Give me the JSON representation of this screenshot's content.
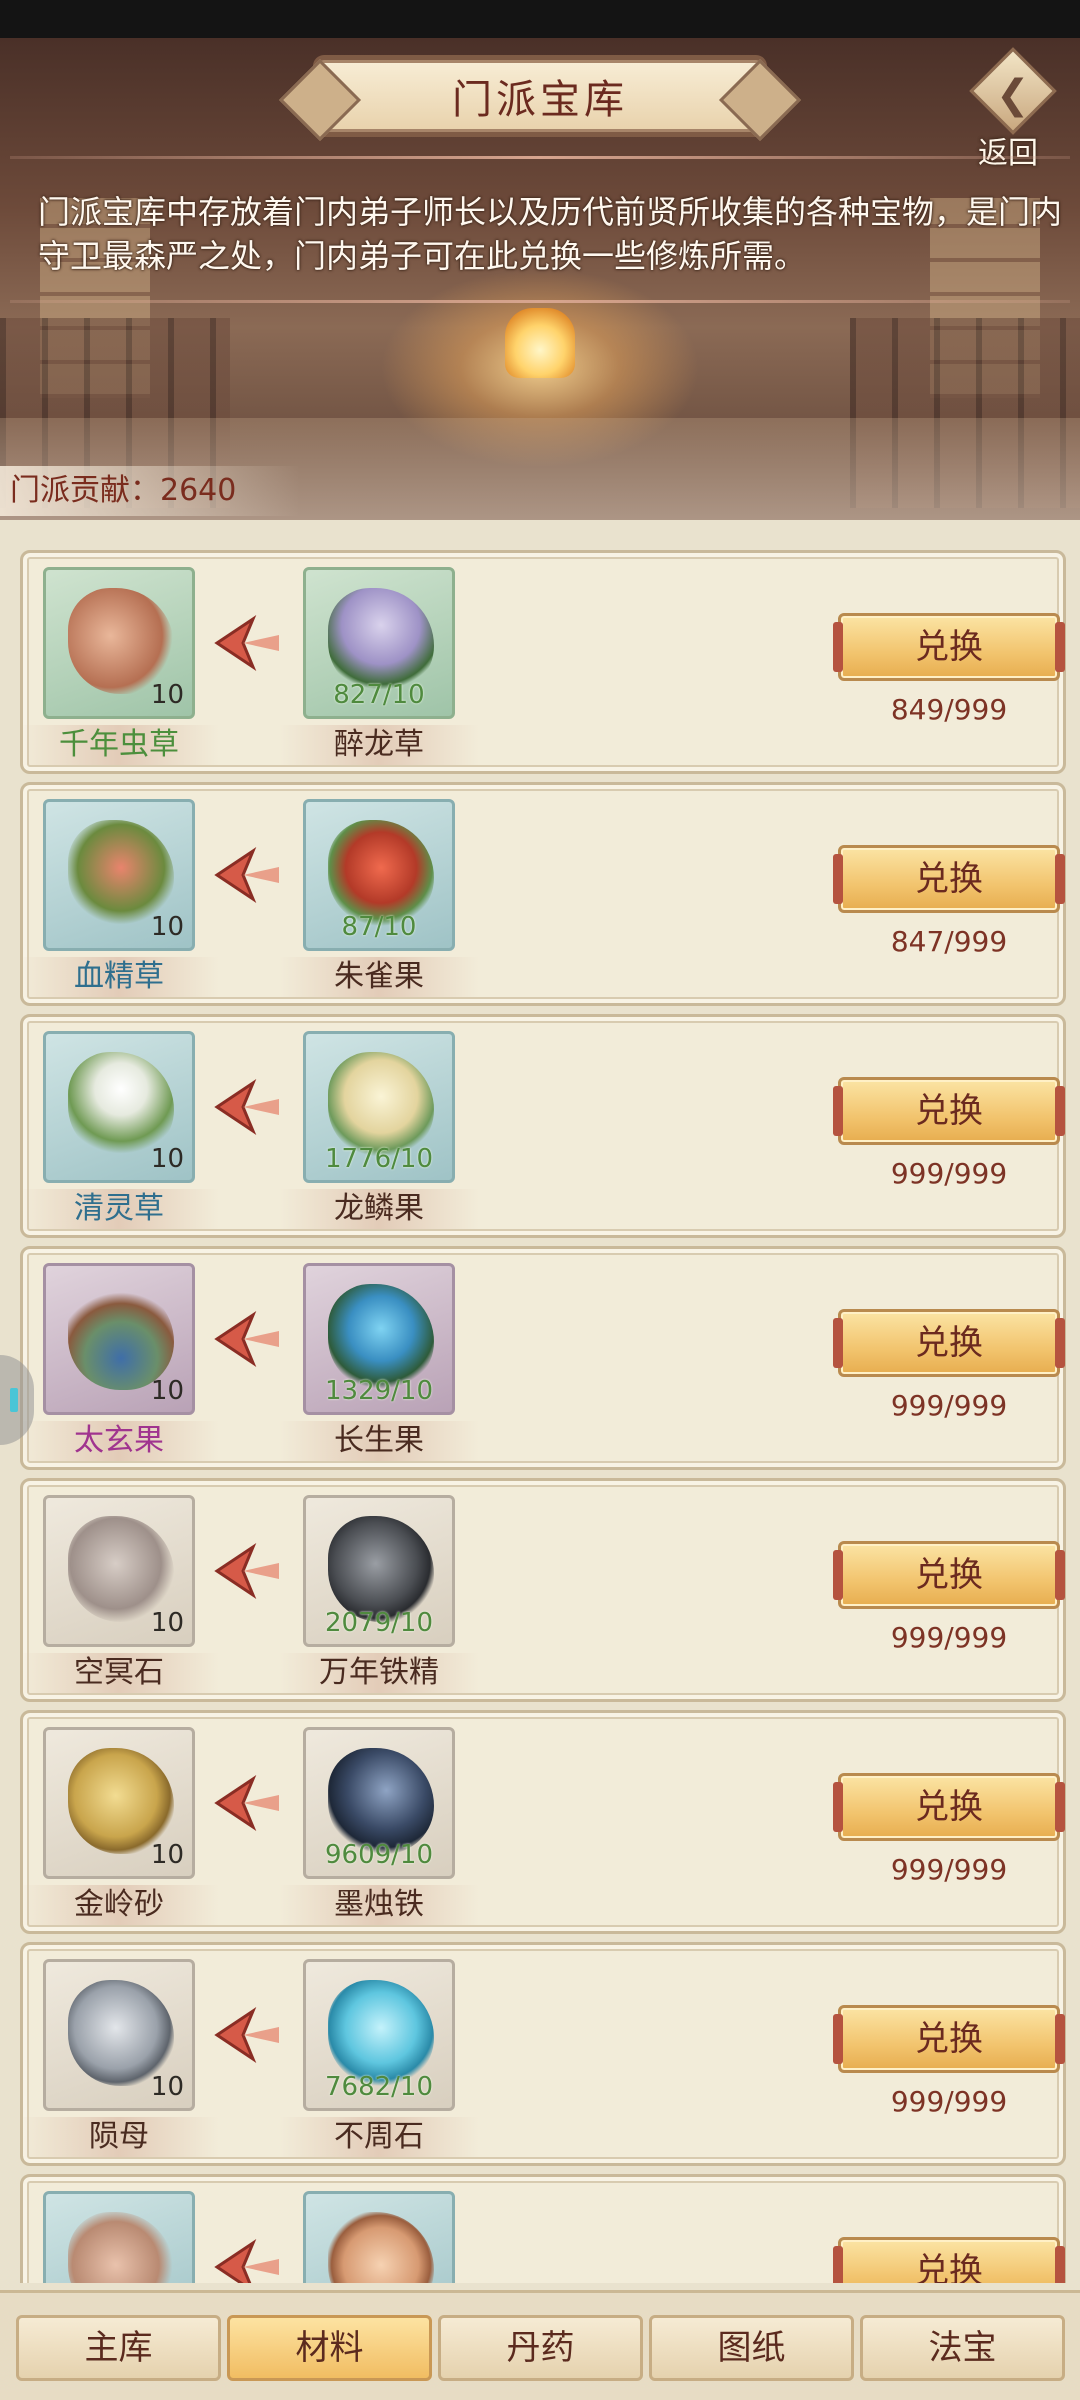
{
  "header": {
    "title": "门派宝库",
    "back_label": "返回",
    "description": "门派宝库中存放着门内弟子师长以及历代前贤所收集的各种宝物，是门内守卫最森严之处，门内弟子可在此兑换一些修炼所需。",
    "contribution_label": "门派贡献：2640"
  },
  "items": [
    {
      "target_name": "千年虫草",
      "target_qty": "10",
      "target_rarity": "green",
      "source_name": "醉龙草",
      "source_qty": "827/10",
      "source_rarity": "green",
      "button": "兑换",
      "stock": "849/999"
    },
    {
      "target_name": "血精草",
      "target_qty": "10",
      "target_rarity": "blue",
      "source_name": "朱雀果",
      "source_qty": "87/10",
      "source_rarity": "blue",
      "button": "兑换",
      "stock": "847/999"
    },
    {
      "target_name": "清灵草",
      "target_qty": "10",
      "target_rarity": "blue",
      "source_name": "龙鳞果",
      "source_qty": "1776/10",
      "source_rarity": "blue",
      "button": "兑换",
      "stock": "999/999"
    },
    {
      "target_name": "太玄果",
      "target_qty": "10",
      "target_rarity": "purple",
      "source_name": "长生果",
      "source_qty": "1329/10",
      "source_rarity": "purple",
      "button": "兑换",
      "stock": "999/999"
    },
    {
      "target_name": "空冥石",
      "target_qty": "10",
      "target_rarity": "grey",
      "source_name": "万年铁精",
      "source_qty": "2079/10",
      "source_rarity": "grey",
      "button": "兑换",
      "stock": "999/999"
    },
    {
      "target_name": "金岭砂",
      "target_qty": "10",
      "target_rarity": "grey",
      "source_name": "墨烛铁",
      "source_qty": "9609/10",
      "source_rarity": "grey",
      "button": "兑换",
      "stock": "999/999"
    },
    {
      "target_name": "陨母",
      "target_qty": "10",
      "target_rarity": "grey",
      "source_name": "不周石",
      "source_qty": "7682/10",
      "source_rarity": "grey",
      "button": "兑换",
      "stock": "999/999"
    },
    {
      "target_name": "",
      "target_qty": "",
      "target_rarity": "blue",
      "source_name": "",
      "source_qty": "",
      "source_rarity": "blue",
      "button": "兑换",
      "stock": ""
    }
  ],
  "tabs": [
    {
      "label": "主库",
      "active": false
    },
    {
      "label": "材料",
      "active": true
    },
    {
      "label": "丹药",
      "active": false
    },
    {
      "label": "图纸",
      "active": false
    },
    {
      "label": "法宝",
      "active": false
    }
  ],
  "colors": {
    "rarity_green": "#4c8f3c",
    "rarity_blue": "#2f6f8e",
    "rarity_purple": "#a0348f",
    "stock_text": "#7d3325",
    "button_gold": "#f2c46e"
  },
  "icons": {
    "item_1_target": "cordyceps-icon",
    "item_1_source": "lavender-herb-icon",
    "item_2_target": "blood-herb-icon",
    "item_2_source": "red-berry-icon",
    "item_3_target": "white-flower-icon",
    "item_3_source": "dragon-scale-fruit-icon",
    "item_4_target": "blue-fruit-branch-icon",
    "item_4_source": "blue-berry-vine-icon",
    "item_5_target": "pale-stone-icon",
    "item_5_source": "dark-iron-ore-icon",
    "item_6_target": "gold-sand-icon",
    "item_6_source": "black-crystal-iron-icon",
    "item_7_target": "grey-ore-icon",
    "item_7_source": "blue-crystal-stone-icon",
    "arrow": "left-arrow-icon"
  }
}
